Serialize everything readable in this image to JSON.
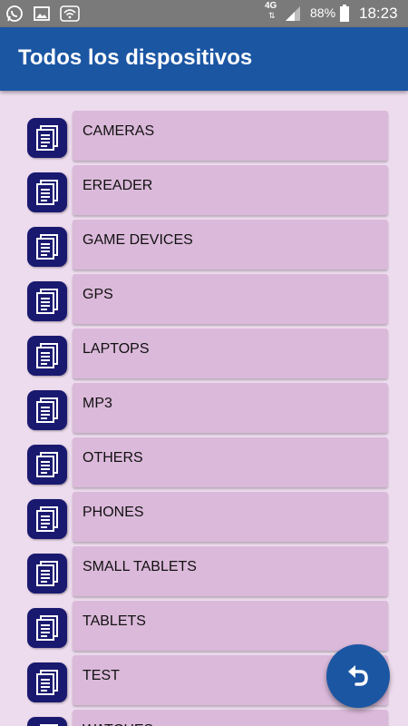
{
  "status_bar": {
    "network": "4G",
    "battery": "88%",
    "time": "18:23",
    "icons": [
      "whatsapp-icon",
      "image-icon",
      "wifi-icon",
      "signal-icon",
      "battery-icon"
    ]
  },
  "app_bar": {
    "title": "Todos los dispositivos"
  },
  "colors": {
    "primary": "#1b56a3",
    "icon_background": "#1a1970",
    "item_background": "#dbb9da",
    "page_background": "#eddcee"
  },
  "devices": [
    {
      "label": "CAMERAS",
      "icon": "document-icon"
    },
    {
      "label": "EREADER",
      "icon": "document-icon"
    },
    {
      "label": "GAME DEVICES",
      "icon": "document-icon"
    },
    {
      "label": "GPS",
      "icon": "document-icon"
    },
    {
      "label": "LAPTOPS",
      "icon": "document-icon"
    },
    {
      "label": "MP3",
      "icon": "document-icon"
    },
    {
      "label": "OTHERS",
      "icon": "document-icon"
    },
    {
      "label": "PHONES",
      "icon": "document-icon"
    },
    {
      "label": "SMALL TABLETS",
      "icon": "document-icon"
    },
    {
      "label": "TABLETS",
      "icon": "document-icon"
    },
    {
      "label": "TEST",
      "icon": "document-icon"
    },
    {
      "label": "WATCHES",
      "icon": "document-icon"
    }
  ],
  "fab": {
    "icon": "undo-icon"
  }
}
